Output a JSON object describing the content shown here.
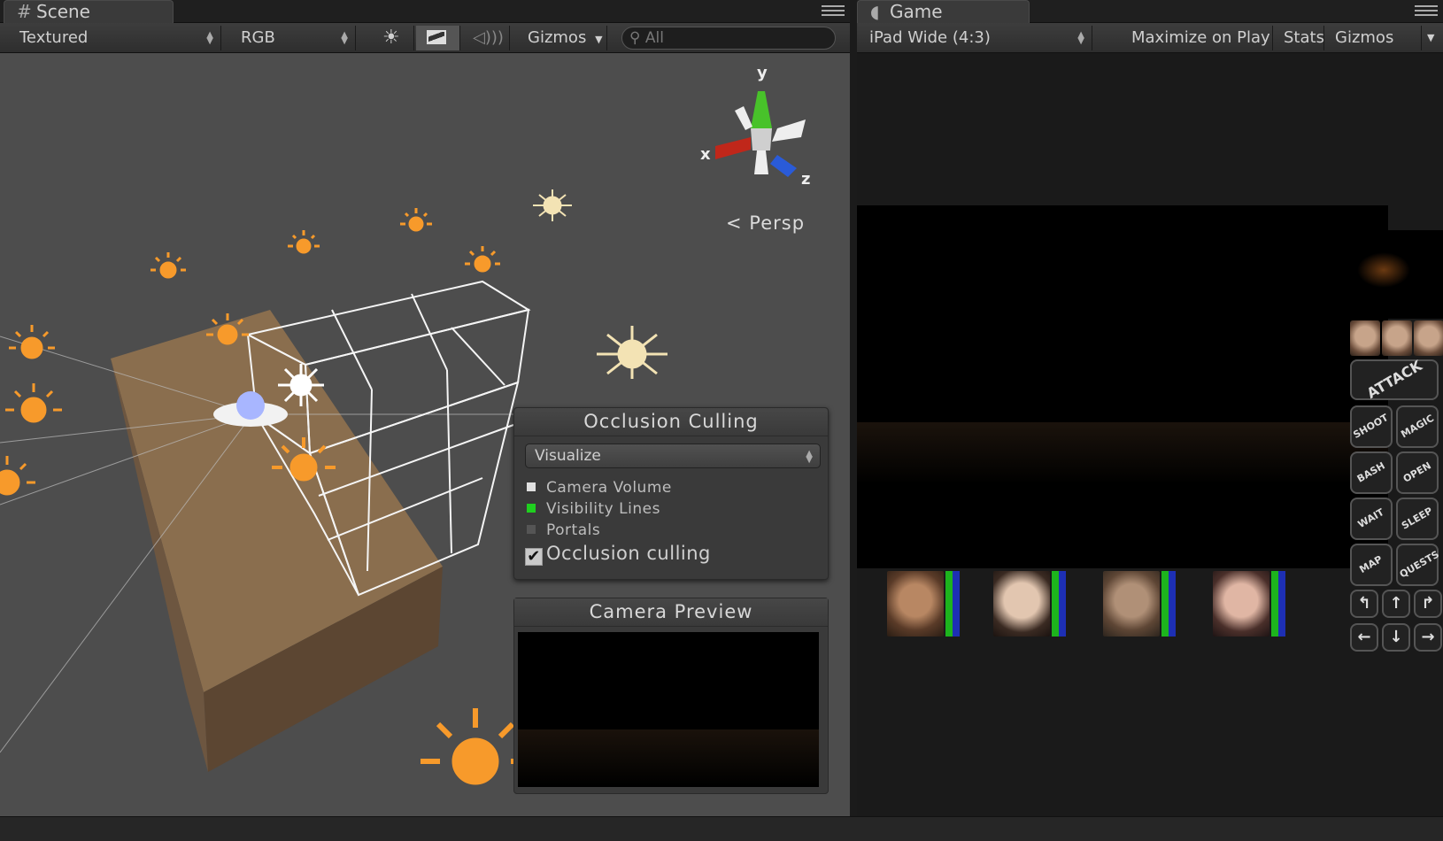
{
  "scene_tab": {
    "label": "Scene",
    "icon": "grid-icon"
  },
  "game_tab": {
    "label": "Game",
    "icon": "pacman-icon"
  },
  "scene_toolbar": {
    "render_mode": "Textured",
    "channel": "RGB",
    "gizmos_label": "Gizmos",
    "search_placeholder": "All"
  },
  "game_toolbar": {
    "aspect": "iPad Wide (4:3)",
    "maximize_label": "Maximize on Play",
    "stats_label": "Stats",
    "gizmos_label": "Gizmos"
  },
  "scene": {
    "projection_label": "Persp",
    "axis_x": "x",
    "axis_y": "y",
    "axis_z": "z"
  },
  "occlusion_panel": {
    "title": "Occlusion Culling",
    "mode": "Visualize",
    "legend": [
      {
        "label": "Camera Volume",
        "color": "#e0e0e0"
      },
      {
        "label": "Visibility Lines",
        "color": "#1fcf1f"
      },
      {
        "label": "Portals",
        "color": "#555555"
      }
    ],
    "checkbox_label": "Occlusion culling",
    "checkbox_checked": true
  },
  "camera_preview": {
    "title": "Camera Preview"
  },
  "game": {
    "buttons": [
      "ATTACK",
      "SHOOT",
      "MAGIC",
      "BASH",
      "OPEN",
      "WAIT",
      "SLEEP",
      "MAP",
      "QUESTS"
    ]
  }
}
